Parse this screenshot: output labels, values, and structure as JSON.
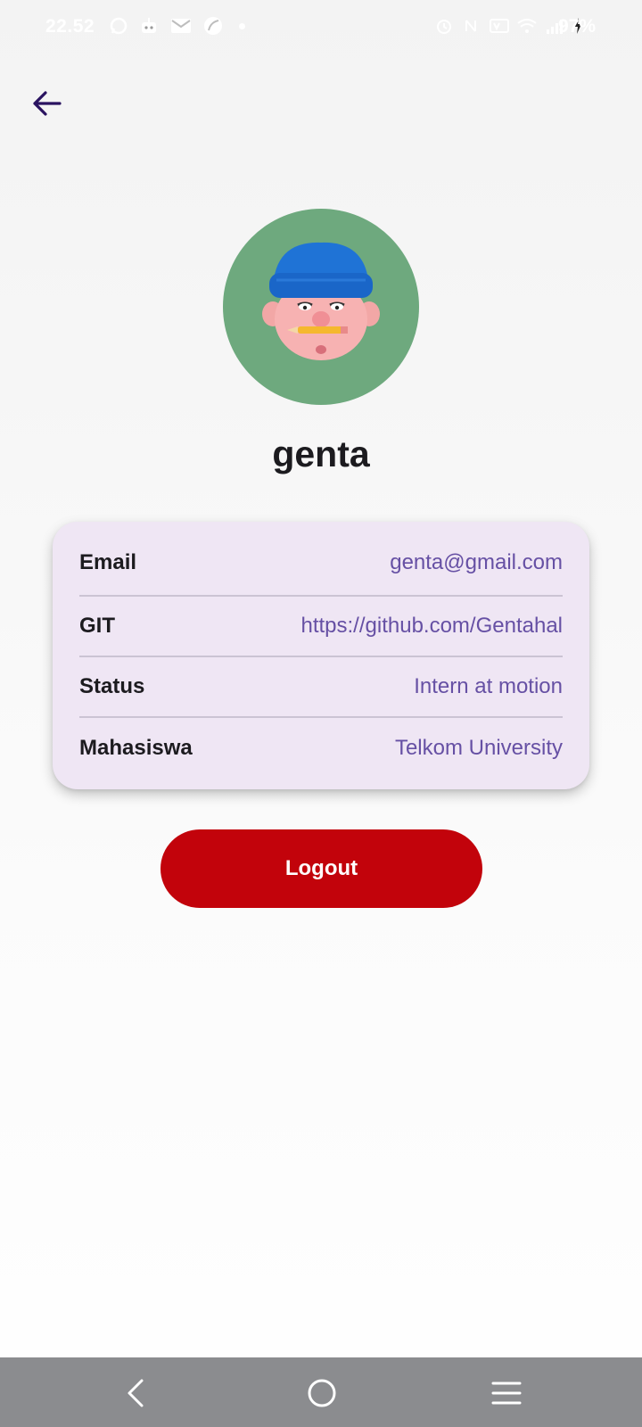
{
  "status_bar": {
    "time": "22.52",
    "battery": "97%",
    "left_icons": [
      "whatsapp-icon",
      "bot-icon",
      "mail-icon",
      "leaf-icon",
      "dot-icon"
    ],
    "right_icons": [
      "alarm-icon",
      "nfc-icon",
      "volte-icon",
      "wifi-icon",
      "signal-icon",
      "charging-icon"
    ]
  },
  "app_bar": {
    "back_icon": "arrow-left-icon",
    "icon_color": "#2a1360"
  },
  "profile": {
    "username": "genta",
    "avatar_bg": "#6ea97e"
  },
  "info": {
    "rows": [
      {
        "label": "Email",
        "value": "genta@gmail.com"
      },
      {
        "label": "GIT",
        "value": "https://github.com/Gentahal"
      },
      {
        "label": "Status",
        "value": "Intern at motion"
      },
      {
        "label": "Mahasiswa",
        "value": "Telkom University"
      }
    ],
    "card_bg": "#efe6f4",
    "value_color": "#6650a4"
  },
  "logout": {
    "label": "Logout",
    "color": "#c2030b"
  },
  "nav_bar": {
    "icons": [
      "back-chevron-icon",
      "home-circle-icon",
      "menu-icon"
    ],
    "bg": "#8b8c8f"
  }
}
